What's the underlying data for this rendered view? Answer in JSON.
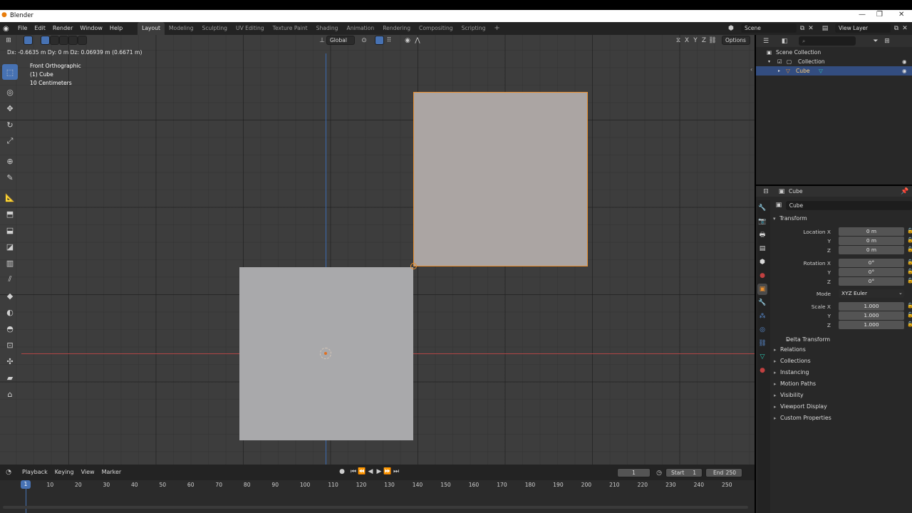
{
  "window": {
    "title": "Blender",
    "min": "—",
    "restore": "❐",
    "close": "✕"
  },
  "menus": [
    "File",
    "Edit",
    "Render",
    "Window",
    "Help"
  ],
  "workspaces": [
    "Layout",
    "Modeling",
    "Sculpting",
    "UV Editing",
    "Texture Paint",
    "Shading",
    "Animation",
    "Rendering",
    "Compositing",
    "Scripting"
  ],
  "active_workspace": "Layout",
  "add_tab": "+",
  "scene": {
    "label": "Scene",
    "view_layer": "View Layer"
  },
  "viewport": {
    "status": "Dx: -0.6635 m  Dy: 0 m  Dz: 0.06939 m (0.6671 m)",
    "view_name": "Front Orthographic",
    "object_name": "(1) Cube",
    "scale": "10 Centimeters",
    "transform_orientation": "Global",
    "axes": [
      "X",
      "Y",
      "Z"
    ],
    "options": "Options"
  },
  "tools": [
    "select-box-icon",
    "cursor-icon",
    "move-icon",
    "rotate-icon",
    "scale-icon",
    "transform-icon",
    "annotate-icon",
    "measure-icon",
    "extrude-icon",
    "inset-icon",
    "bevel-icon",
    "loop-cut-icon",
    "knife-icon",
    "poly-build-icon",
    "spin-icon",
    "smooth-icon",
    "edge-slide-icon",
    "shrink-icon",
    "shear-icon",
    "rip-icon"
  ],
  "tool_glyphs": [
    "⬚",
    "◎",
    "✥",
    "↻",
    "⤢",
    "⊕",
    "✎",
    "📐",
    "⬒",
    "⬓",
    "◪",
    "▥",
    "⫽",
    "◆",
    "◐",
    "◓",
    "⊡",
    "✣",
    "▰",
    "⌂"
  ],
  "timeline": {
    "menus": [
      "Playback",
      "Keying",
      "View",
      "Marker"
    ],
    "current_frame": "1",
    "start_label": "Start",
    "start": "1",
    "end_label": "End",
    "end": "250",
    "ticks": [
      "1",
      "10",
      "20",
      "30",
      "40",
      "50",
      "60",
      "70",
      "80",
      "90",
      "100",
      "110",
      "120",
      "130",
      "140",
      "150",
      "160",
      "170",
      "180",
      "190",
      "200",
      "210",
      "220",
      "230",
      "240",
      "250"
    ],
    "frame_marker": "1"
  },
  "outliner": {
    "scene_collection": "Scene Collection",
    "collection": "Collection",
    "object": "Cube"
  },
  "properties": {
    "header_object": "Cube",
    "object_name": "Cube",
    "transform_title": "Transform",
    "location": [
      {
        "label": "Location X",
        "value": "0 m"
      },
      {
        "label": "Y",
        "value": "0 m"
      },
      {
        "label": "Z",
        "value": "0 m"
      }
    ],
    "rotation": [
      {
        "label": "Rotation X",
        "value": "0°"
      },
      {
        "label": "Y",
        "value": "0°"
      },
      {
        "label": "Z",
        "value": "0°"
      }
    ],
    "mode_label": "Mode",
    "mode_value": "XYZ Euler",
    "scale": [
      {
        "label": "Scale X",
        "value": "1.000"
      },
      {
        "label": "Y",
        "value": "1.000"
      },
      {
        "label": "Z",
        "value": "1.000"
      }
    ],
    "delta": "Delta Transform",
    "panels": [
      "Relations",
      "Collections",
      "Instancing",
      "Motion Paths",
      "Visibility",
      "Viewport Display",
      "Custom Properties"
    ]
  },
  "colors": {
    "accent": "#4772b3",
    "selected_outline": "#e98f2f",
    "x_axis": "#c03a3a",
    "z_axis": "#2c5da8"
  }
}
